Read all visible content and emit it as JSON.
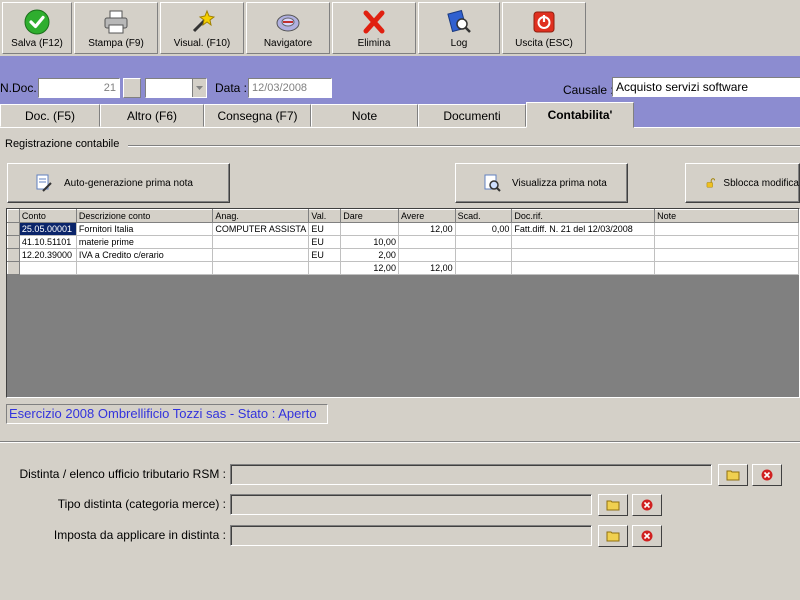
{
  "toolbar": {
    "buttons": [
      {
        "label": "Salva (F12)",
        "icon": "check-icon"
      },
      {
        "label": "Stampa (F9)",
        "icon": "printer-icon"
      },
      {
        "label": "Visual. (F10)",
        "icon": "magic-wand-icon"
      },
      {
        "label": "Navigatore",
        "icon": "navigator-icon"
      },
      {
        "label": "Elimina",
        "icon": "delete-x-icon"
      },
      {
        "label": "Log",
        "icon": "log-icon"
      },
      {
        "label": "Uscita (ESC)",
        "icon": "exit-icon"
      }
    ]
  },
  "header": {
    "ndoc_label": "N.Doc. :",
    "ndoc_value": "21",
    "data_label": "Data :",
    "data_value": "12/03/2008",
    "causale_label": "Causale :",
    "causale_value": "Acquisto servizi software"
  },
  "tabs": [
    {
      "label": "Doc. (F5)"
    },
    {
      "label": "Altro (F6)"
    },
    {
      "label": "Consegna (F7)"
    },
    {
      "label": "Note"
    },
    {
      "label": "Documenti"
    },
    {
      "label": "Contabilita'",
      "active": true
    }
  ],
  "registrazione": {
    "title": "Registrazione contabile",
    "btn_autogen": "Auto-generazione prima nota",
    "btn_visualizza": "Visualizza prima nota",
    "btn_sblocca": "Sblocca modifica"
  },
  "grid": {
    "columns": [
      "Conto",
      "Descrizione conto",
      "Anag.",
      "Val.",
      "Dare",
      "Avere",
      "Scad.",
      "Doc.rif.",
      "Note"
    ],
    "rows": [
      [
        "25.05.00001",
        "Fornitori Italia",
        "COMPUTER ASSISTA",
        "EU",
        "",
        "12,00",
        "0,00",
        "Fatt.diff. N. 21 del 12/03/2008",
        ""
      ],
      [
        "41.10.51101",
        "materie prime",
        "",
        "EU",
        "10,00",
        "",
        "",
        "",
        ""
      ],
      [
        "12.20.39000",
        "IVA a Credito c/erario",
        "",
        "EU",
        "2,00",
        "",
        "",
        "",
        ""
      ],
      [
        "",
        "",
        "",
        "",
        "12,00",
        "12,00",
        "",
        "",
        ""
      ]
    ]
  },
  "status": {
    "text": "Esercizio 2008 Ombrellificio Tozzi sas - Stato : Aperto",
    "color": "#3333dd"
  },
  "bottom": {
    "distinta_label": "Distinta / elenco ufficio tributario RSM :",
    "tipo_label": "Tipo distinta (categoria merce) :",
    "imposta_label": "Imposta da applicare in distinta :"
  },
  "colors": {
    "header_band": "#8c8cd0",
    "face": "#d4d0c8",
    "selection": "#0a246a"
  }
}
